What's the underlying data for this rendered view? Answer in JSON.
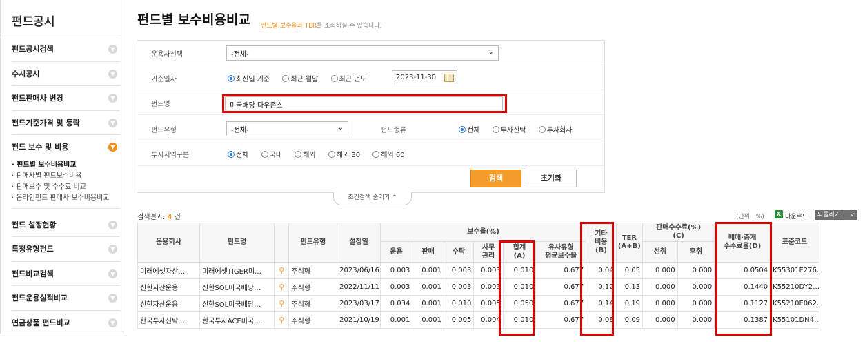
{
  "sidebar": {
    "title": "펀드공시",
    "items": [
      {
        "label": "펀드공시검색"
      },
      {
        "label": "수시공시"
      },
      {
        "label": "펀드판매사 변경"
      },
      {
        "label": "펀드기준가격 및 등락"
      },
      {
        "label": "펀드 보수 및 비용"
      },
      {
        "label": "펀드 설정현황"
      },
      {
        "label": "특정유형펀드"
      },
      {
        "label": "펀드비교검색"
      },
      {
        "label": "펀드운용실적비교"
      },
      {
        "label": "연금상품 펀드비교"
      }
    ],
    "sub_items": [
      {
        "label": "· 펀드별 보수비용비교"
      },
      {
        "label": "· 판매사별 펀드보수비용"
      },
      {
        "label": "· 판매보수 및 수수료 비교"
      },
      {
        "label": "· 온라인펀드 판매사 보수비용비교"
      }
    ]
  },
  "header": {
    "title": "펀드별 보수비용비교",
    "subtitle_highlight": "펀드별 보수율과 TER",
    "subtitle_rest": "를 조회하실 수 있습니다."
  },
  "form": {
    "manager_label": "운용사선택",
    "manager_value": "-전체-",
    "date_label": "기준일자",
    "date_options": [
      "최신일 기준",
      "최근 월말",
      "최근 년도"
    ],
    "date_value": "2023-11-30",
    "fund_name_label": "펀드명",
    "fund_name_value": "미국배당 다우존스",
    "fund_type_label": "펀드유형",
    "fund_type_value": "-전체-",
    "fund_kind_label": "펀드종류",
    "fund_kind_options": [
      "전체",
      "투자신탁",
      "투자회사"
    ],
    "region_label": "투자지역구분",
    "region_options": [
      "전체",
      "국내",
      "해외",
      "해외 30",
      "해외 60"
    ],
    "search_button": "검색",
    "reset_button": "초기화",
    "toggle_label": "조건검색 숨기기"
  },
  "results": {
    "prefix": "검색결과:",
    "count": "4",
    "suffix": "건",
    "unit": "(단위 : %)",
    "download": "다운로드",
    "back": "되돌리기"
  },
  "table": {
    "headers": {
      "manager": "운용회사",
      "fund": "펀드명",
      "type": "펀드유형",
      "date": "설정일",
      "fee_group": "보수율(%)",
      "mgmt": "운용",
      "sales": "판매",
      "trust": "수탁",
      "office_1": "사무",
      "office_2": "관리",
      "total_1": "합계",
      "total_2": "(A)",
      "similar_1": "유사유형",
      "similar_2": "평균보수율",
      "other_1": "기타",
      "other_2": "비용",
      "other_3": "(B)",
      "ter_1": "TER",
      "ter_2": "(A+B)",
      "comm_group_1": "판매수수료(%)",
      "comm_group_2": "(C)",
      "front": "선취",
      "back": "후취",
      "trade_1": "매매·중개",
      "trade_2": "수수료율(D)",
      "code": "표준코드"
    },
    "rows": [
      {
        "manager": "미래에셋자산…",
        "fund": "미래에셋TIGER미…",
        "type": "주식형",
        "date": "2023/06/16",
        "mgmt": "0.003",
        "sales": "0.001",
        "trust": "0.003",
        "office": "0.003",
        "total": "0.010",
        "similar": "0.677",
        "other": "0.04",
        "ter": "0.05",
        "front": "0.000",
        "back": "0.000",
        "trade": "0.0504",
        "code": "K55301E276…"
      },
      {
        "manager": "신한자산운용",
        "fund": "신한SOL미국배당…",
        "type": "주식형",
        "date": "2022/11/11",
        "mgmt": "0.003",
        "sales": "0.001",
        "trust": "0.003",
        "office": "0.003",
        "total": "0.010",
        "similar": "0.677",
        "other": "0.12",
        "ter": "0.13",
        "front": "0.000",
        "back": "0.000",
        "trade": "0.1440",
        "code": "K55210DY2…"
      },
      {
        "manager": "신한자산운용",
        "fund": "신한SOL미국배당…",
        "type": "주식형",
        "date": "2023/03/17",
        "mgmt": "0.034",
        "sales": "0.001",
        "trust": "0.010",
        "office": "0.005",
        "total": "0.050",
        "similar": "0.677",
        "other": "0.14",
        "ter": "0.19",
        "front": "0.000",
        "back": "0.000",
        "trade": "0.1127",
        "code": "K55210E062…"
      },
      {
        "manager": "한국투자신탁…",
        "fund": "한국투자ACE미국…",
        "type": "주식형",
        "date": "2021/10/19",
        "mgmt": "0.001",
        "sales": "0.001",
        "trust": "0.005",
        "office": "0.004",
        "total": "0.010",
        "similar": "0.677",
        "other": "0.08",
        "ter": "0.09",
        "front": "0.000",
        "back": "0.000",
        "trade": "0.1387",
        "code": "K55101DN4…"
      }
    ]
  }
}
